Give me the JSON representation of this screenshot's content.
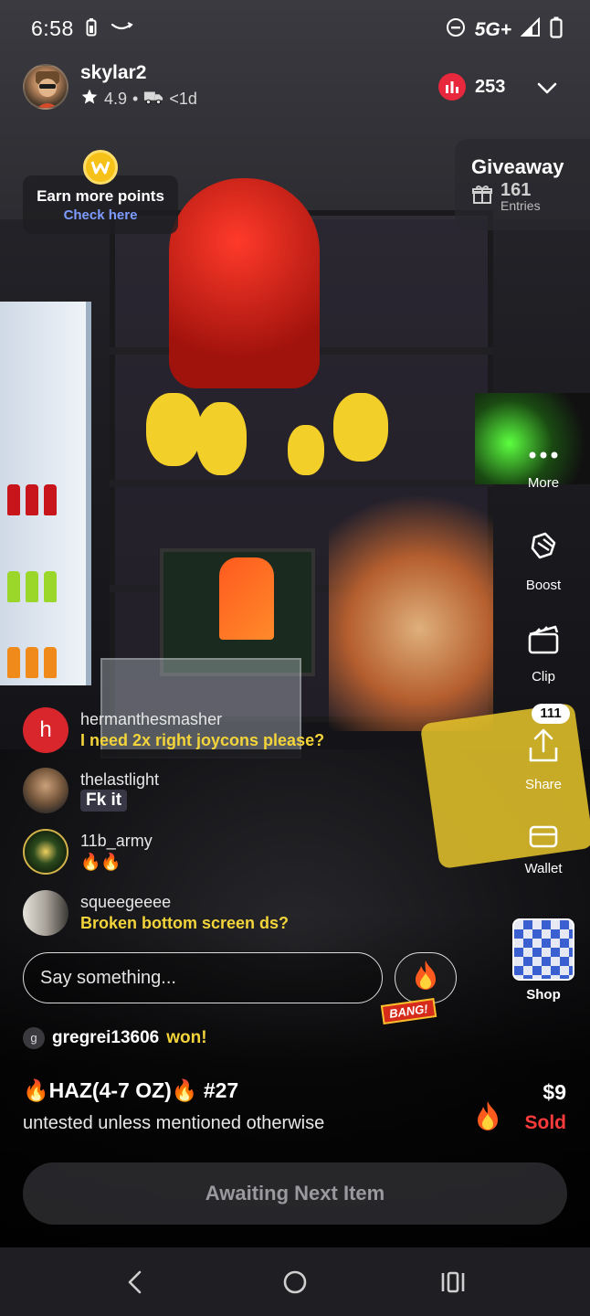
{
  "status_bar": {
    "time": "6:58",
    "network": "5G+"
  },
  "host": {
    "username": "skylar2",
    "rating": "4.9",
    "separator": "•",
    "ship_time": "<1d"
  },
  "viewers": {
    "count": "253"
  },
  "points": {
    "title": "Earn more points",
    "link": "Check here"
  },
  "giveaway": {
    "title": "Giveaway",
    "entries_count": "161",
    "entries_label": "Entries"
  },
  "rail": {
    "more": "More",
    "boost": "Boost",
    "clip": "Clip",
    "share": "Share",
    "share_badge": "111",
    "wallet": "Wallet",
    "shop": "Shop"
  },
  "chat": [
    {
      "user": "hermanthesmasher",
      "initial": "h",
      "message": "I need 2x right joycons please?",
      "avatar_color": "#d8262c"
    },
    {
      "user": "thelastlight",
      "message": "Fk it"
    },
    {
      "user": "11b_army",
      "message": "🔥🔥"
    },
    {
      "user": "squeegeeee",
      "message": "Broken bottom screen ds?"
    }
  ],
  "input": {
    "placeholder": "Say something..."
  },
  "bang_label": "BANG!",
  "auction": {
    "winner_initial": "g",
    "winner": "gregrei13606",
    "won_label": "won!",
    "title": "🔥HAZ(4-7 OZ)🔥 #27",
    "subtitle": "untested unless mentioned otherwise",
    "price": "$9",
    "status": "Sold",
    "button_label": "Awaiting Next Item"
  },
  "colors": {
    "accent_yellow": "#f3d43a",
    "sold_red": "#ff3b3b",
    "viewer_dot": "#e8283c",
    "link_blue": "#7e9bff"
  }
}
